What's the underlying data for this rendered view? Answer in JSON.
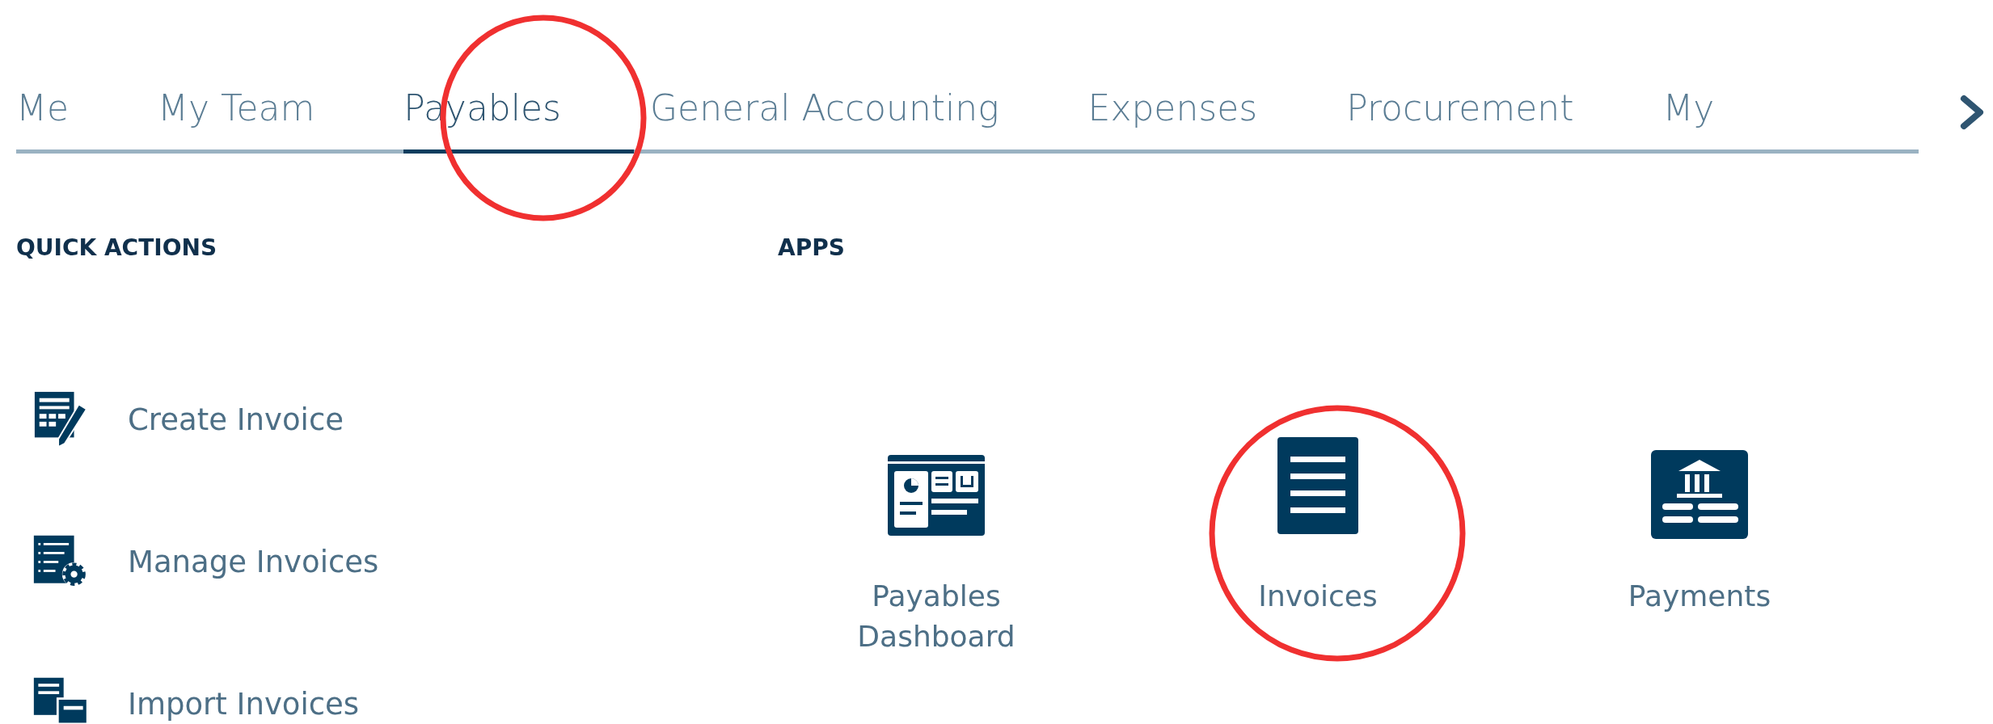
{
  "tabs": [
    {
      "label": "Me",
      "selected": false
    },
    {
      "label": "My Team",
      "selected": false
    },
    {
      "label": "Payables",
      "selected": true
    },
    {
      "label": "General Accounting",
      "selected": false
    },
    {
      "label": "Expenses",
      "selected": false
    },
    {
      "label": "Procurement",
      "selected": false
    },
    {
      "label": "My",
      "selected": false
    }
  ],
  "quick_actions": {
    "heading": "QUICK ACTIONS",
    "items": [
      {
        "label": "Create Invoice",
        "kind": "create"
      },
      {
        "label": "Manage Invoices",
        "kind": "manage"
      },
      {
        "label": "Import Invoices",
        "kind": "import"
      }
    ]
  },
  "apps": {
    "heading": "APPS",
    "items": [
      {
        "label": "Payables Dashboard",
        "kind": "dashboard"
      },
      {
        "label": "Invoices",
        "kind": "document"
      },
      {
        "label": "Payments",
        "kind": "bank"
      }
    ]
  }
}
